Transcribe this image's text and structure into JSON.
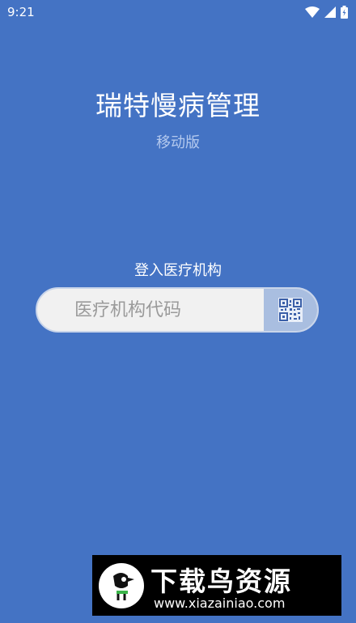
{
  "status_bar": {
    "time": "9:21",
    "icons": [
      "wifi-icon",
      "signal-icon",
      "battery-icon"
    ]
  },
  "app": {
    "title": "瑞特慢病管理",
    "subtitle": "移动版"
  },
  "login": {
    "label": "登入医疗机构",
    "code_placeholder": "医疗机构代码",
    "code_value": "",
    "scan_icon": "qr-code-icon"
  },
  "watermark": {
    "name": "下载鸟资源",
    "url": "www.xiazainiao.com"
  },
  "colors": {
    "background": "#4473C4",
    "subtitle": "#B4C9EE",
    "input_background": "#F1F1F1",
    "scan_button": "#A9BEE0"
  }
}
